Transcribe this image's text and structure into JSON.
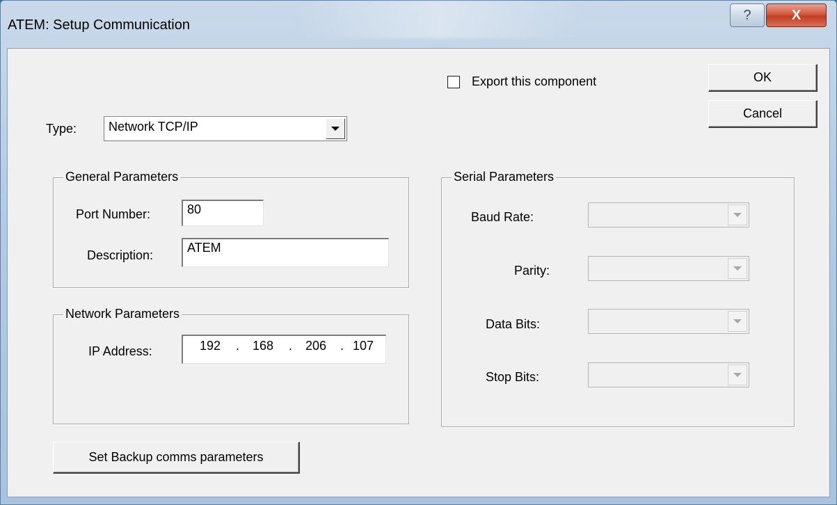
{
  "window": {
    "title": "ATEM: Setup Communication",
    "help_label": "?",
    "close_label": "X"
  },
  "buttons": {
    "ok": "OK",
    "cancel": "Cancel",
    "backup": "Set Backup comms parameters"
  },
  "export": {
    "label": "Export this component",
    "checked": false
  },
  "type": {
    "label": "Type:",
    "value": "Network TCP/IP"
  },
  "general": {
    "title": "General Parameters",
    "port_label": "Port Number:",
    "port_value": "80",
    "description_label": "Description:",
    "description_value": "ATEM"
  },
  "network": {
    "title": "Network Parameters",
    "ip_label": "IP Address:",
    "ip": [
      "192",
      "168",
      "206",
      "107"
    ],
    "dot": "."
  },
  "serial": {
    "title": "Serial Parameters",
    "baud_label": "Baud Rate:",
    "parity_label": "Parity:",
    "databits_label": "Data Bits:",
    "stopbits_label": "Stop Bits:"
  }
}
